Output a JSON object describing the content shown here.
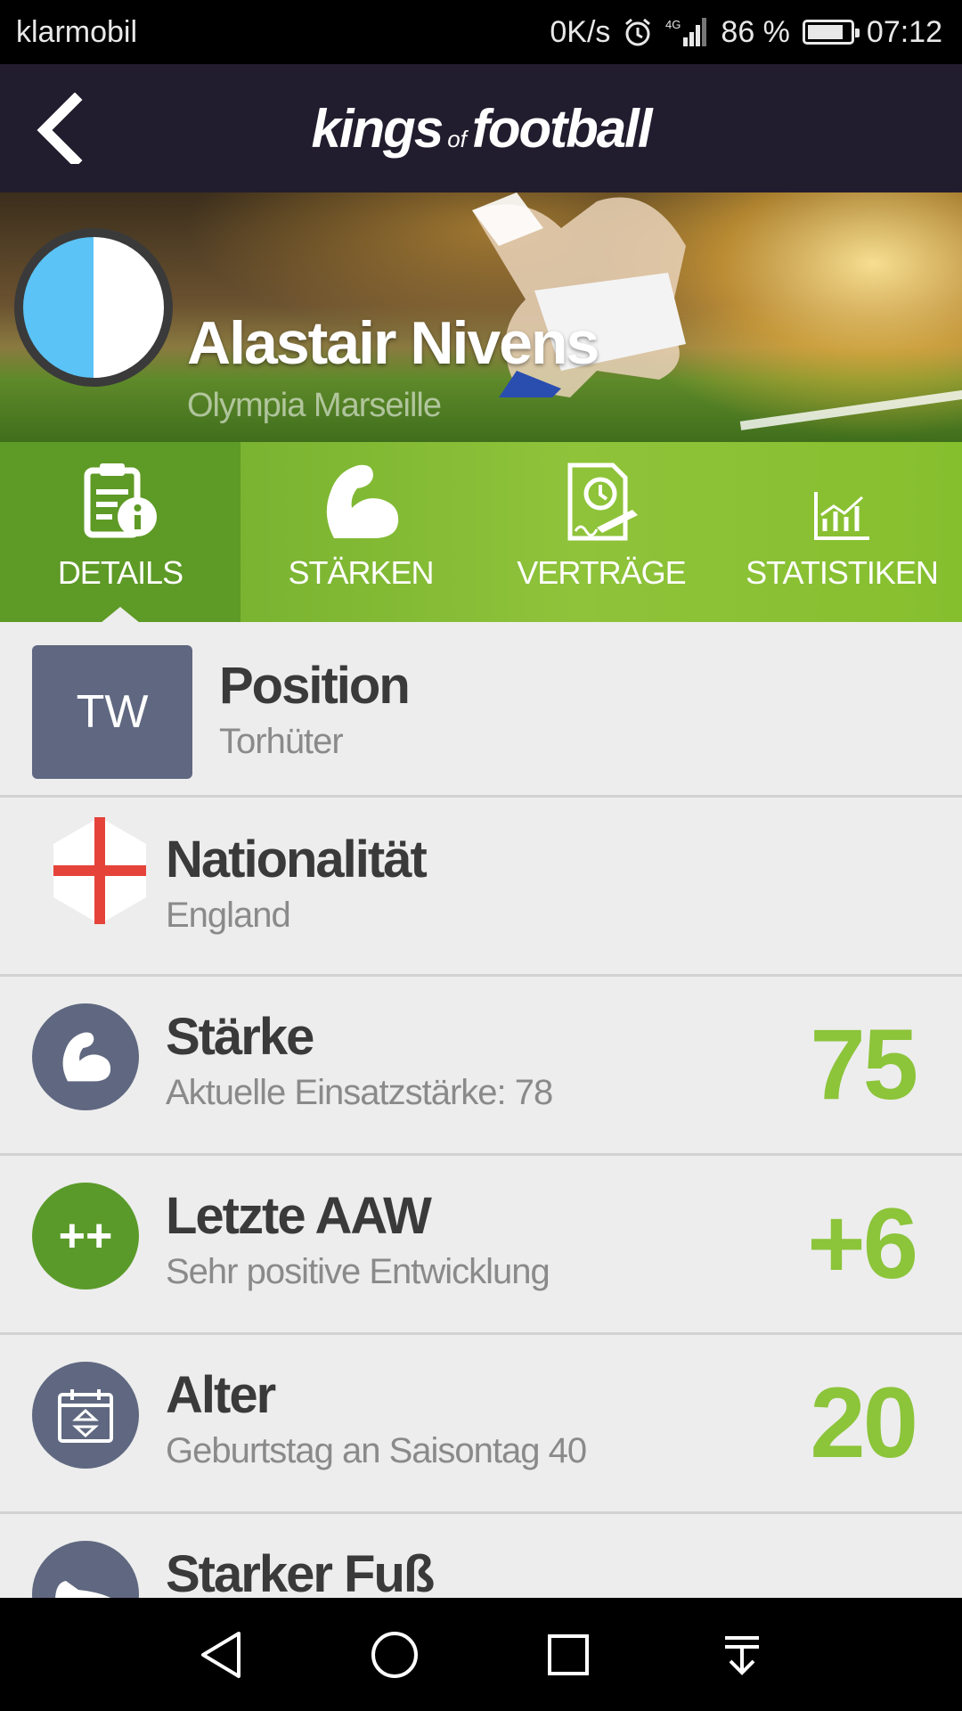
{
  "status_bar": {
    "carrier": "klarmobil",
    "speed": "0K/s",
    "network": "4G",
    "battery": "86 %",
    "battery_level": 0.86,
    "time": "07:12"
  },
  "app": {
    "logo_main_1": "kings",
    "logo_of": "of",
    "logo_main_2": "football"
  },
  "player": {
    "name": "Alastair Nivens",
    "club": "Olympia Marseille",
    "avatar_colors": [
      "#5bc3f5",
      "#ffffff"
    ]
  },
  "tabs": [
    {
      "label": "DETAILS",
      "icon": "details-info-icon",
      "active": true
    },
    {
      "label": "STÄRKEN",
      "icon": "muscle-icon",
      "active": false
    },
    {
      "label": "VERTRÄGE",
      "icon": "contract-icon",
      "active": false
    },
    {
      "label": "STATISTIKEN",
      "icon": "chart-icon",
      "active": false
    }
  ],
  "details": {
    "position": {
      "code": "TW",
      "title": "Position",
      "value": "Torhüter"
    },
    "nationality": {
      "title": "Nationalität",
      "value": "England",
      "flag_icon": "england-flag-icon"
    },
    "strength": {
      "title": "Stärke",
      "subtitle": "Aktuelle Einsatzstärke: 78",
      "value": "75",
      "icon": "muscle-icon"
    },
    "last_aaw": {
      "title": "Letzte AAW",
      "subtitle": "Sehr positive Entwicklung",
      "value": "+6",
      "badge": "++"
    },
    "age": {
      "title": "Alter",
      "subtitle": "Geburtstag an Saisontag 40",
      "value": "20",
      "icon": "calendar-icon"
    },
    "strong_foot": {
      "title": "Starker Fuß",
      "icon": "shoe-icon"
    }
  },
  "colors": {
    "accent_green": "#8cc43a",
    "header_dark": "#221d2e",
    "icon_slate": "#5f6880",
    "badge_green": "#5a9a2a"
  }
}
